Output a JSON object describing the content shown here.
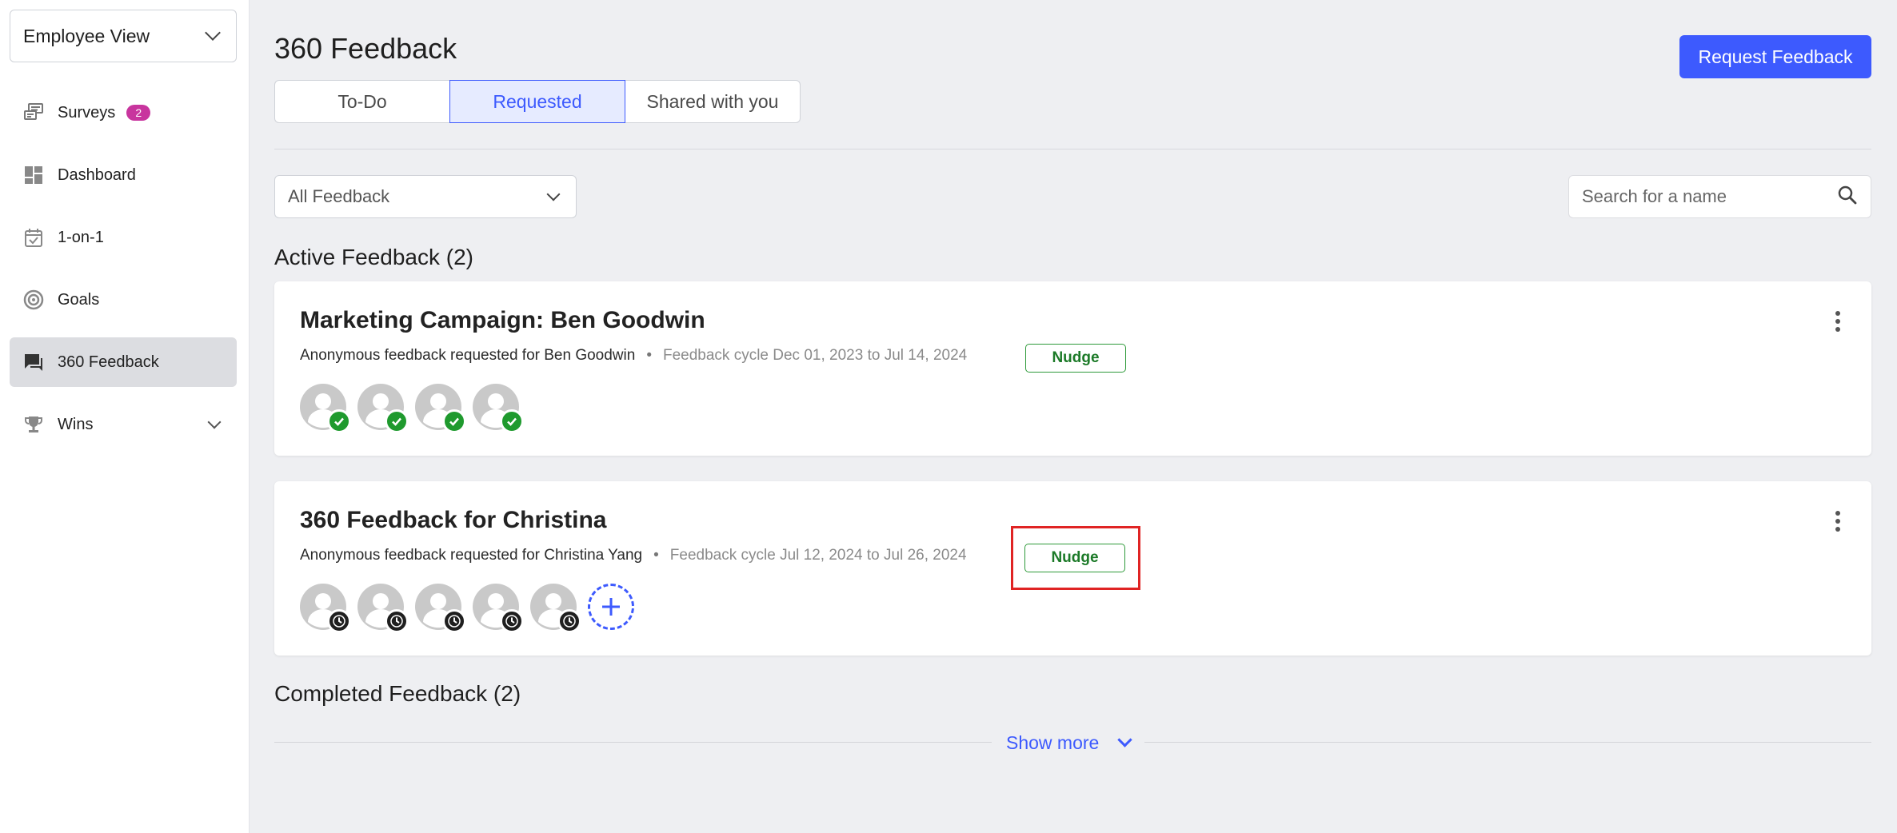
{
  "sidebar": {
    "view_selector": "Employee View",
    "items": [
      {
        "label": "Surveys",
        "badge": "2",
        "icon": "survey-icon"
      },
      {
        "label": "Dashboard",
        "icon": "dashboard-icon"
      },
      {
        "label": "1-on-1",
        "icon": "calendar-check-icon"
      },
      {
        "label": "Goals",
        "icon": "target-icon"
      },
      {
        "label": "360 Feedback",
        "icon": "chat-icon",
        "active": true
      },
      {
        "label": "Wins",
        "icon": "trophy-icon"
      }
    ]
  },
  "header": {
    "title": "360 Feedback",
    "request_button": "Request Feedback"
  },
  "tabs": [
    {
      "label": "To-Do"
    },
    {
      "label": "Requested",
      "active": true
    },
    {
      "label": "Shared with you"
    }
  ],
  "filter": {
    "selected": "All Feedback"
  },
  "search": {
    "placeholder": "Search for a name"
  },
  "active_section": {
    "title": "Active Feedback (2)"
  },
  "cards": [
    {
      "title": "Marketing Campaign: Ben Goodwin",
      "requested": "Anonymous feedback requested for Ben Goodwin",
      "separator": "•",
      "cycle": "Feedback cycle Dec 01, 2023 to Jul 14, 2024",
      "nudge": "Nudge",
      "reviewers_done": 4,
      "reviewers_pending": 0
    },
    {
      "title": "360 Feedback for Christina",
      "requested": "Anonymous feedback requested for Christina Yang",
      "separator": "•",
      "cycle": "Feedback cycle Jul 12, 2024 to Jul 26, 2024",
      "nudge": "Nudge",
      "reviewers_done": 0,
      "reviewers_pending": 5
    }
  ],
  "completed_section": {
    "title": "Completed Feedback (2)"
  },
  "show_more": "Show more",
  "colors": {
    "accent": "#3d5afe",
    "nudge_green": "#1c7a28",
    "badge_pink": "#c8359e",
    "highlight_red": "#e02424"
  }
}
